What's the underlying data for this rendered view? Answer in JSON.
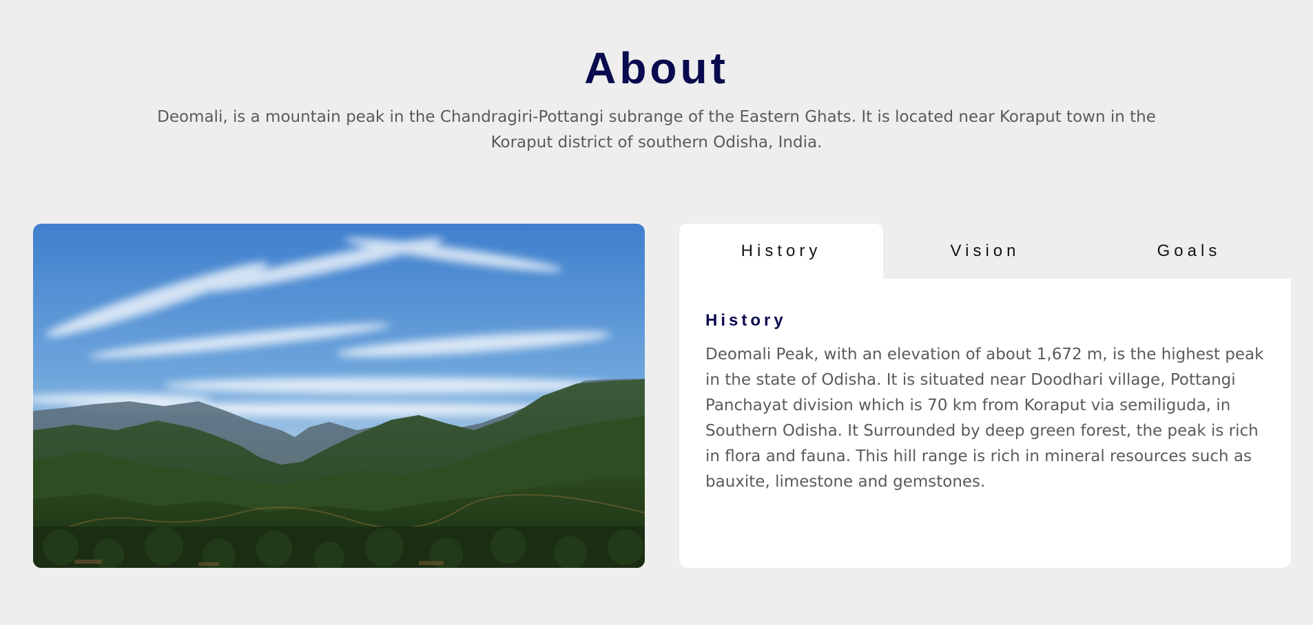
{
  "about": {
    "title": "About",
    "description": "Deomali, is a mountain peak in the Chandragiri-Pottangi subrange of the Eastern Ghats. It is located near Koraput town in the Koraput district of southern Odisha, India."
  },
  "tabs": [
    {
      "label": "History",
      "active": true
    },
    {
      "label": "Vision",
      "active": false
    },
    {
      "label": "Goals",
      "active": false
    }
  ],
  "panel": {
    "heading": "History",
    "body": "Deomali Peak, with an elevation of about 1,672 m, is the highest peak in the state of Odisha. It is situated near Doodhari village, Pottangi Panchayat division which is 70 km from Koraput via semiliguda, in Southern Odisha. It Surrounded by deep green forest, the peak is rich in flora and fauna. This hill range is rich in mineral resources such as bauxite, limestone and gemstones."
  },
  "colors": {
    "page_background": "#eeeeee",
    "title": "#0a0a4f",
    "body_text": "#5a5a5a",
    "card_background": "#ffffff"
  }
}
